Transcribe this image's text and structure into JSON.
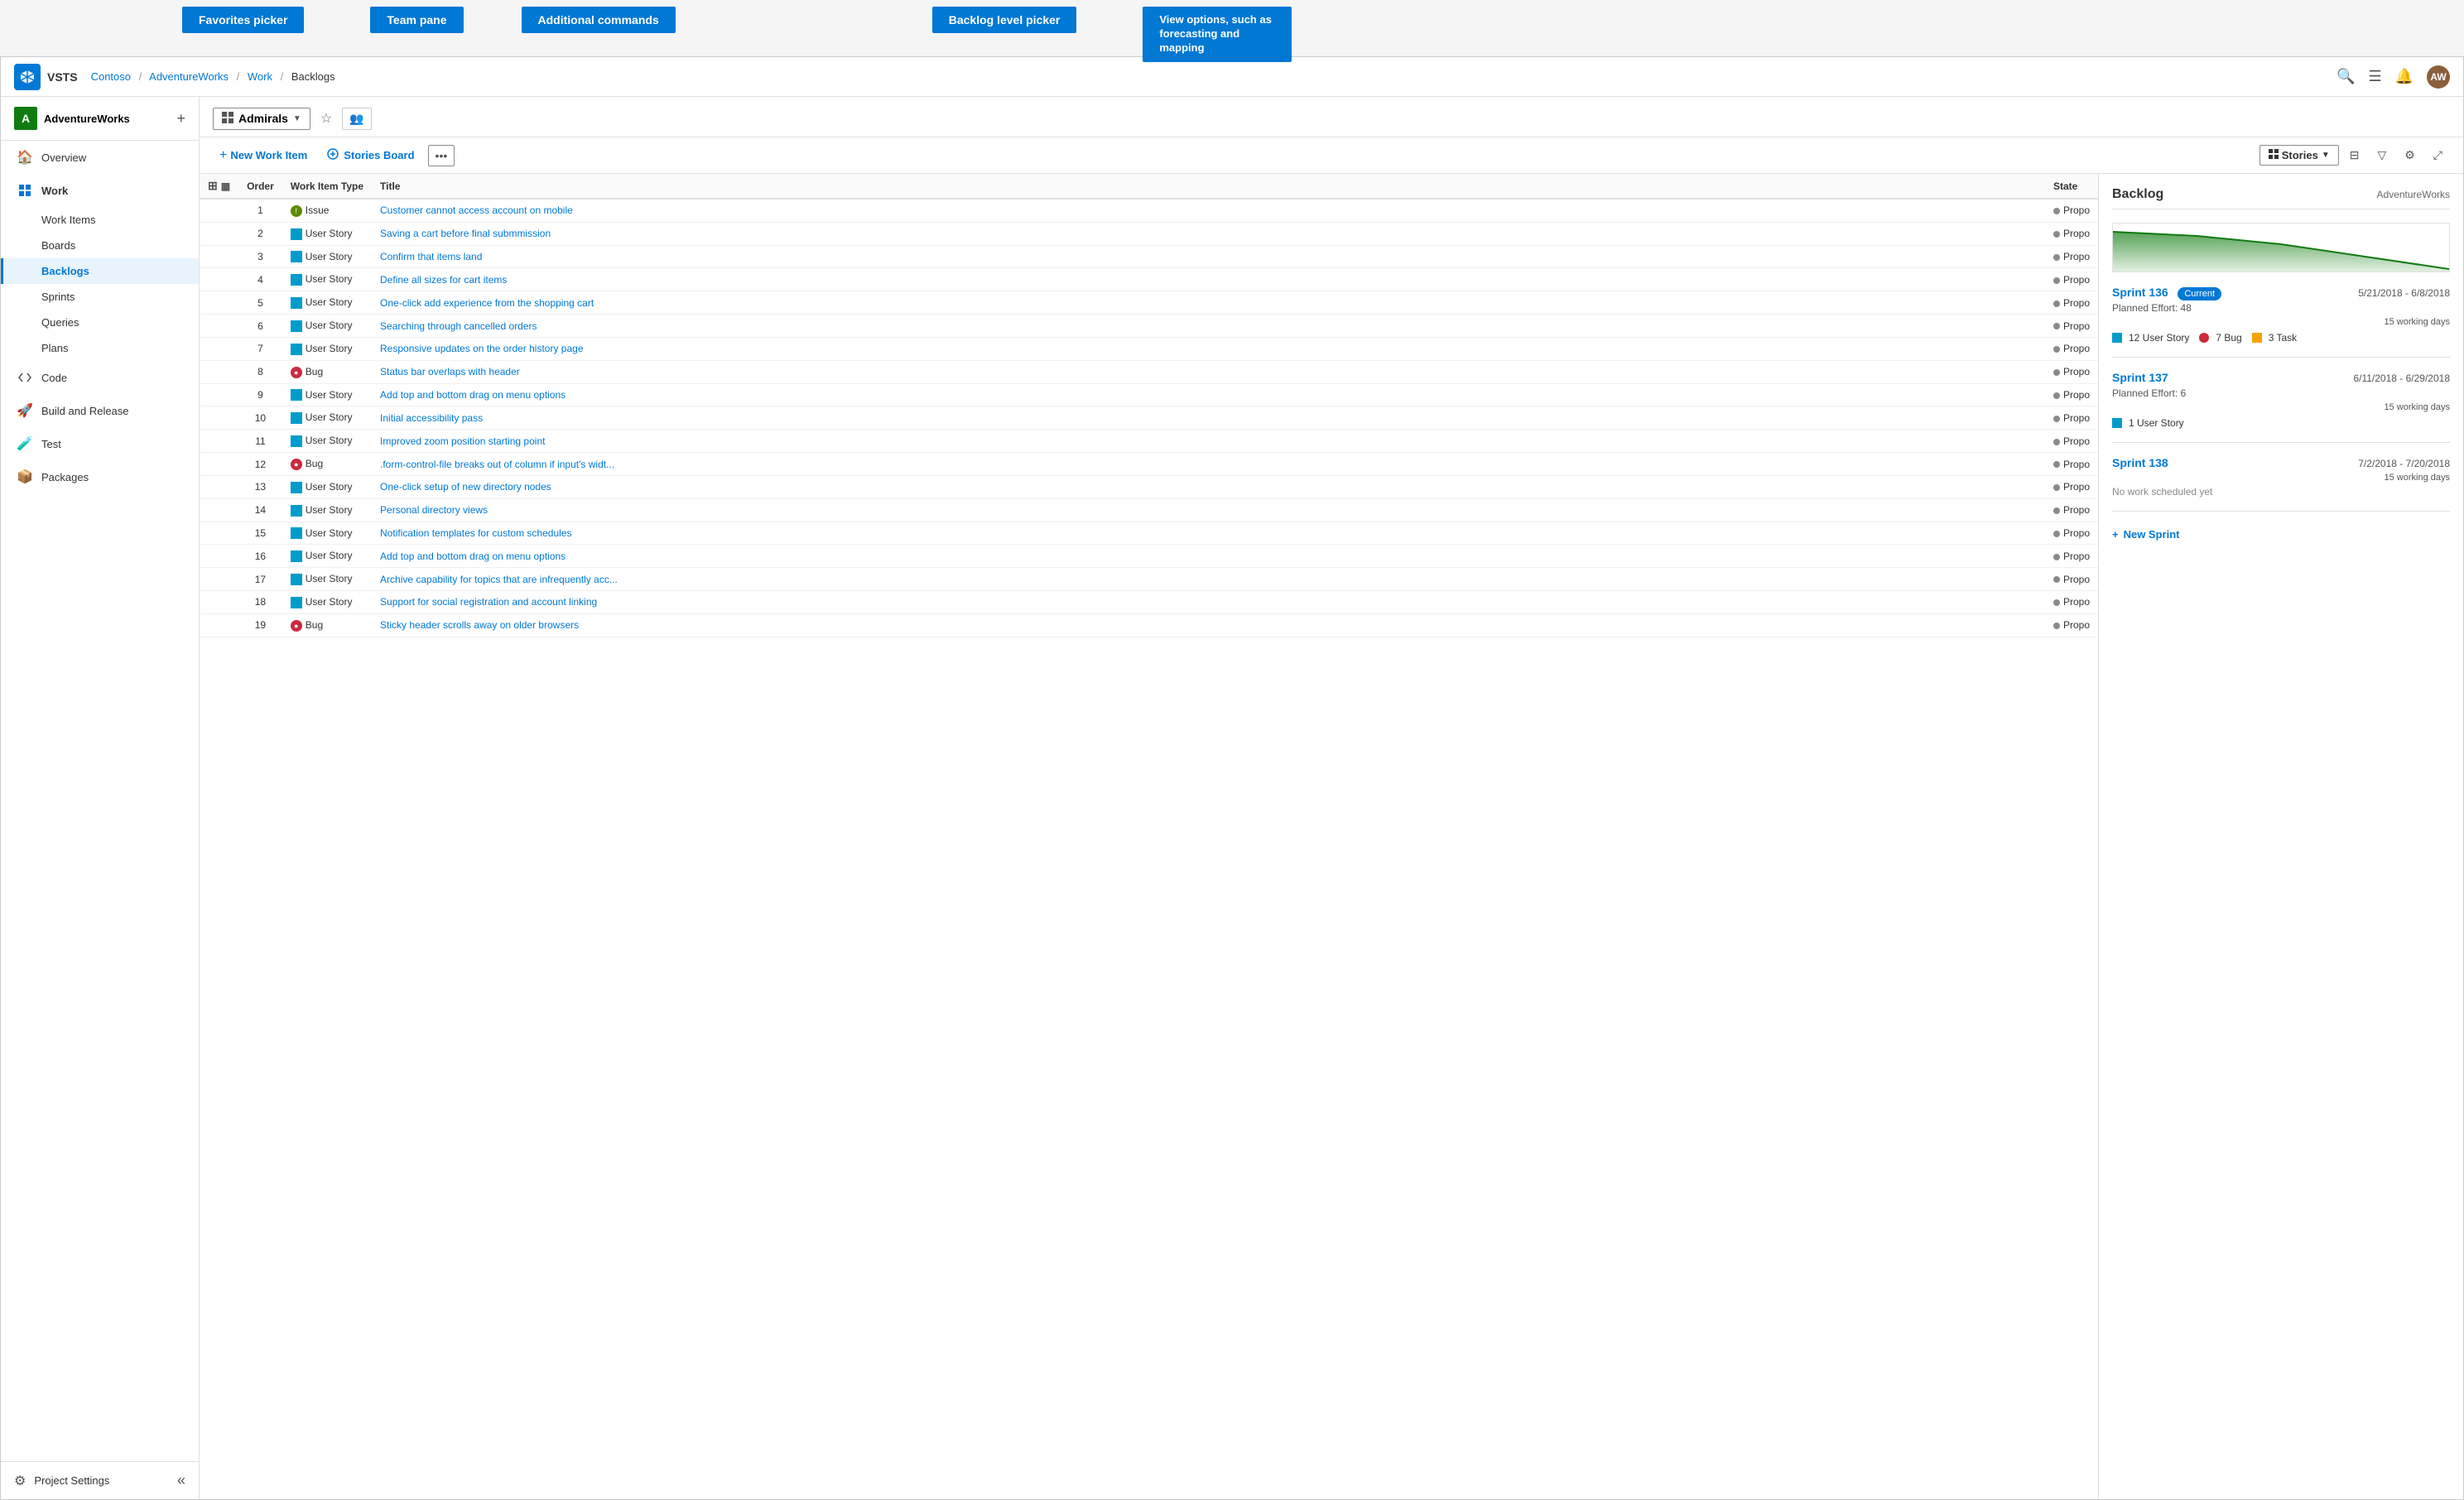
{
  "annotation": {
    "favorites_picker": "Favorites picker",
    "team_pane": "Team pane",
    "additional_commands": "Additional commands",
    "backlog_level_picker": "Backlog level picker",
    "view_options": "View options, such as forecasting and mapping"
  },
  "topbar": {
    "logo_text": "V",
    "app_name": "VSTS",
    "breadcrumb": [
      "Contoso",
      "AdventureWorks",
      "Work",
      "Backlogs"
    ],
    "search_icon": "🔍",
    "list_icon": "☰",
    "bell_icon": "🔔",
    "avatar_text": "AW"
  },
  "sidebar": {
    "project_name": "AdventureWorks",
    "project_initial": "A",
    "nav_items": [
      {
        "id": "overview",
        "label": "Overview",
        "icon": "🏠"
      },
      {
        "id": "work",
        "label": "Work",
        "icon": "📋",
        "expanded": true,
        "sub_items": [
          {
            "id": "work-items",
            "label": "Work Items"
          },
          {
            "id": "boards",
            "label": "Boards"
          },
          {
            "id": "backlogs",
            "label": "Backlogs",
            "active": true
          },
          {
            "id": "sprints",
            "label": "Sprints"
          },
          {
            "id": "queries",
            "label": "Queries"
          },
          {
            "id": "plans",
            "label": "Plans"
          }
        ]
      },
      {
        "id": "code",
        "label": "Code",
        "icon": "💻"
      },
      {
        "id": "build-release",
        "label": "Build and Release",
        "icon": "🚀"
      },
      {
        "id": "test",
        "label": "Test",
        "icon": "🧪"
      },
      {
        "id": "packages",
        "label": "Packages",
        "icon": "📦"
      }
    ],
    "project_settings": "Project Settings",
    "collapse_icon": "«"
  },
  "toolbar": {
    "team_name": "Admirals",
    "team_icon": "☰",
    "favorites_icon": "☆",
    "members_icon": "👥"
  },
  "action_bar": {
    "new_work_item": "New Work Item",
    "stories_board": "Stories Board",
    "more_icon": "...",
    "stories_label": "Stories",
    "view_options_icon": "⊟",
    "filter_icon": "⊝",
    "settings_icon": "⚙",
    "expand_icon": "⤢"
  },
  "backlog_table": {
    "headers": [
      "",
      "Order",
      "Work Item Type",
      "Title",
      "State"
    ],
    "rows": [
      {
        "order": 1,
        "type": "Issue",
        "type_icon": "issue",
        "title": "Customer cannot access account on mobile",
        "state": "Propo"
      },
      {
        "order": 2,
        "type": "User Story",
        "type_icon": "story",
        "title": "Saving a cart before final submmission",
        "state": "Propo"
      },
      {
        "order": 3,
        "type": "User Story",
        "type_icon": "story",
        "title": "Confirm that items land",
        "state": "Propo"
      },
      {
        "order": 4,
        "type": "User Story",
        "type_icon": "story",
        "title": "Define all sizes for cart items",
        "state": "Propo"
      },
      {
        "order": 5,
        "type": "User Story",
        "type_icon": "story",
        "title": "One-click add experience from the shopping cart",
        "state": "Propo"
      },
      {
        "order": 6,
        "type": "User Story",
        "type_icon": "story",
        "title": "Searching through cancelled orders",
        "state": "Propo"
      },
      {
        "order": 7,
        "type": "User Story",
        "type_icon": "story",
        "title": "Responsive updates on the order history page",
        "state": "Propo"
      },
      {
        "order": 8,
        "type": "Bug",
        "type_icon": "bug",
        "title": "Status bar overlaps with header",
        "state": "Propo"
      },
      {
        "order": 9,
        "type": "User Story",
        "type_icon": "story",
        "title": "Add top and bottom drag on menu options",
        "state": "Propo"
      },
      {
        "order": 10,
        "type": "User Story",
        "type_icon": "story",
        "title": "Initial accessibility pass",
        "state": "Propo"
      },
      {
        "order": 11,
        "type": "User Story",
        "type_icon": "story",
        "title": "Improved zoom position starting point",
        "state": "Propo"
      },
      {
        "order": 12,
        "type": "Bug",
        "type_icon": "bug",
        "title": ".form-control-file breaks out of column if input's widt...",
        "state": "Propo"
      },
      {
        "order": 13,
        "type": "User Story",
        "type_icon": "story",
        "title": "One-click setup of new directory nodes",
        "state": "Propo"
      },
      {
        "order": 14,
        "type": "User Story",
        "type_icon": "story",
        "title": "Personal directory views",
        "state": "Propo"
      },
      {
        "order": 15,
        "type": "User Story",
        "type_icon": "story",
        "title": "Notification templates for custom schedules",
        "state": "Propo"
      },
      {
        "order": 16,
        "type": "User Story",
        "type_icon": "story",
        "title": "Add top and bottom drag on menu options",
        "state": "Propo"
      },
      {
        "order": 17,
        "type": "User Story",
        "type_icon": "story",
        "title": "Archive capability for topics that are infrequently acc...",
        "state": "Propo"
      },
      {
        "order": 18,
        "type": "User Story",
        "type_icon": "story",
        "title": "Support for social registration and account linking",
        "state": "Propo"
      },
      {
        "order": 19,
        "type": "Bug",
        "type_icon": "bug",
        "title": "Sticky header scrolls away on older browsers",
        "state": "Propo"
      }
    ]
  },
  "backlog_sidebar": {
    "title": "Backlog",
    "org": "AdventureWorks",
    "sprints": [
      {
        "name": "Sprint 136",
        "current": true,
        "current_label": "Current",
        "dates": "5/21/2018 - 6/8/2018",
        "planned_effort": "Planned Effort: 48",
        "working_days": "15 working days",
        "tags": [
          {
            "type": "story",
            "count": 12,
            "label": "User Story"
          },
          {
            "type": "bug",
            "count": 7,
            "label": "Bug"
          },
          {
            "type": "task",
            "count": 3,
            "label": "Task"
          }
        ]
      },
      {
        "name": "Sprint 137",
        "current": false,
        "dates": "6/11/2018 - 6/29/2018",
        "planned_effort": "Planned Effort: 6",
        "working_days": "15 working days",
        "tags": [
          {
            "type": "story",
            "count": 1,
            "label": "User Story"
          }
        ]
      },
      {
        "name": "Sprint 138",
        "current": false,
        "dates": "7/2/2018 - 7/20/2018",
        "planned_effort": null,
        "working_days": "15 working days",
        "no_work": "No work scheduled yet",
        "tags": []
      }
    ],
    "new_sprint_label": "+ New Sprint"
  }
}
